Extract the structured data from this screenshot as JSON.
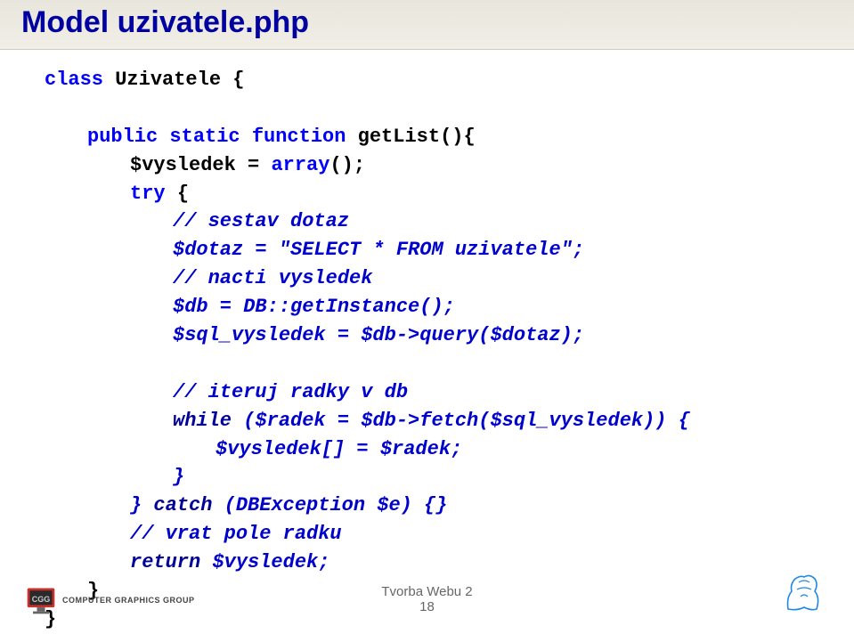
{
  "header": {
    "title": "Model uzivatele.php"
  },
  "code": {
    "l1": {
      "kw1": "class ",
      "id": "Uzivatele ",
      "br": "{"
    },
    "l2": {
      "kw1": "public static function ",
      "id": "getList",
      "paren": "(){"
    },
    "l3": {
      "v": "$vysledek",
      "eq": " = ",
      "kw": "array",
      "p": "();"
    },
    "l4": {
      "kw": "try ",
      "br": "{"
    },
    "l5": "// sestav dotaz",
    "l6": "$dotaz = \"SELECT * FROM uzivatele\";",
    "l7": "// nacti vysledek",
    "l8": "$db = DB::getInstance();",
    "l9": "$sql_vysledek = $db->query($dotaz);",
    "l10": "// iteruj radky v db",
    "l11_a": "while ",
    "l11_b": "($radek = $db->fetch($sql_vysledek)) {",
    "l12": "$vysledek[] = $radek;",
    "l13": "}",
    "l14_a": "} ",
    "l14_b": "catch ",
    "l14_c": "(DBException $e) {}",
    "l15": "// vrat pole radku",
    "l16_a": "return ",
    "l16_b": "$vysledek;",
    "l17": "}",
    "l18": "}"
  },
  "footer": {
    "center_line1": "Tvorba Webu 2",
    "center_line2": "18",
    "left_text": "COMPUTER GRAPHICS GROUP"
  }
}
